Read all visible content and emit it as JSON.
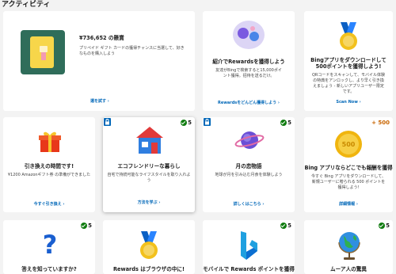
{
  "page": {
    "title": "アクティビティ"
  },
  "cards": [
    {
      "title": "¥736,652 の懸賞",
      "desc": "プリペイド ギフト カードの獲得チャンスに当選して、好きなものを購入しよう",
      "link": "運を試す ›",
      "icon": "gift-card-icon"
    },
    {
      "title": "紹介でRewardsを獲得しよう",
      "desc": "友達がBingで検索すると15,000ポイント獲得。招待を送るだけ。",
      "link": "Rewardsをどんどん獲得しよう ›",
      "icon": "friends-rewards-icon"
    },
    {
      "title": "Bingアプリをダウンロードして500ポイントを獲得しよう!",
      "desc": "QRコードをスキャンして、モバイル体験の特典をアンロックし、より早く引き換えましょう - 新しいアプリユーザー限定です。",
      "link": "Scan Now ›",
      "icon": "medal-icon"
    },
    {
      "title": "引き換えの時間です!",
      "desc": "¥1200 Amazonギフト券 の準備ができました",
      "link": "今すぐ引き換え ›",
      "icon": "gift-box-icon"
    },
    {
      "title": "エコフレンドリーな暮らし",
      "desc": "自宅で持続可能なライフスタイルを取り入れよう",
      "link": "方法を学ぶ ›",
      "icon": "house-icon",
      "points": "5"
    },
    {
      "title": "月の恋物語",
      "desc": "地球が月を引み込む月食を体験しよう",
      "link": "詳しくはこちら ›",
      "icon": "planet-icon",
      "points": "5"
    },
    {
      "title": "Bing アプリならどこでも報酬を獲得",
      "desc": "今すぐ Bing アプリをダウンロードして、新規ユーザーに贈られる 500 ポイントを獲得しよう!",
      "link": "詳細情報 ›",
      "icon": "coin-icon",
      "points": "+ 500",
      "coin_label": "500"
    },
    {
      "title": "答えを知っていますか?",
      "icon": "question-icon",
      "points": "5"
    },
    {
      "title": "Rewards はブラウザの中に!",
      "icon": "medal-icon"
    },
    {
      "title": "モバイルで Rewards ポイントを獲得",
      "icon": "bing-logo-icon",
      "points": "5"
    },
    {
      "title": "ムーア人の驚異",
      "icon": "globe-icon",
      "points": "5"
    }
  ],
  "colors": {
    "link": "#0067b8",
    "check": "#107c10",
    "plus": "#c86400",
    "lock": "#0067b8"
  }
}
